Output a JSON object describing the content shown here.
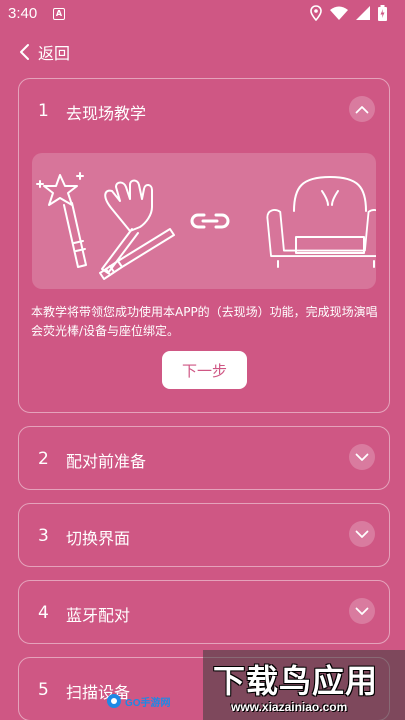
{
  "status_bar": {
    "time": "3:40",
    "notification_badge": "A",
    "icons": [
      "location-icon",
      "wifi-icon",
      "signal-icon",
      "battery-icon"
    ]
  },
  "header": {
    "back_label": "返回"
  },
  "steps": [
    {
      "number": "1",
      "title": "去现场教学",
      "expanded": true,
      "description": "本教学将带领您成功使用本APP的（去现场）功能，完成现场演唱会荧光棒/设备与座位绑定。",
      "button_label": "下一步",
      "illustration_icons": [
        "magic-wand-star-icon",
        "clapper-hand-icon",
        "glow-stick-icon",
        "link-icon",
        "armchair-icon"
      ]
    },
    {
      "number": "2",
      "title": "配对前准备",
      "expanded": false
    },
    {
      "number": "3",
      "title": "切换界面",
      "expanded": false
    },
    {
      "number": "4",
      "title": "蓝牙配对",
      "expanded": false
    },
    {
      "number": "5",
      "title": "扫描设备",
      "expanded": false
    }
  ],
  "watermark": {
    "title": "下载鸟应用",
    "url": "www.xiazainiao.com",
    "small_logo": "GO手游网"
  },
  "colors": {
    "background": "#cf5784",
    "text": "#ffffff",
    "button_text": "#cf5784"
  }
}
